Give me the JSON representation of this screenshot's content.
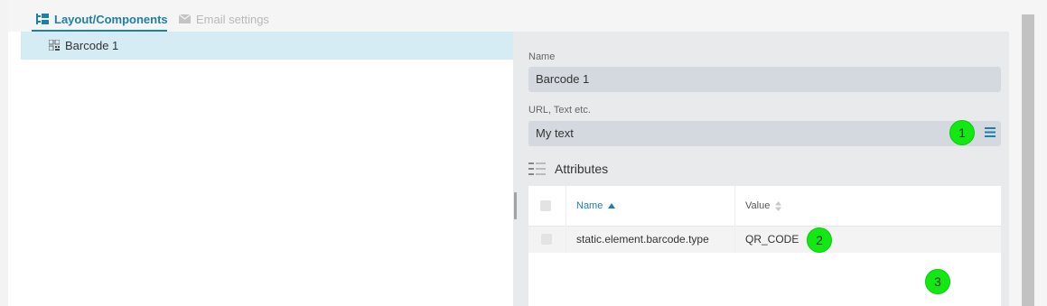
{
  "tabs": [
    {
      "label": "Layout/Components",
      "active": true,
      "icon": "tree-icon"
    },
    {
      "label": "Email settings",
      "active": false,
      "icon": "envelope-icon"
    }
  ],
  "tree": {
    "items": [
      {
        "label": "Barcode 1",
        "icon": "barcode-icon",
        "selected": true
      }
    ]
  },
  "properties": {
    "name_label": "Name",
    "name_value": "Barcode 1",
    "url_label": "URL, Text etc.",
    "url_value": "My text",
    "url_menu_icon": "menu-icon"
  },
  "attributes": {
    "title": "Attributes",
    "icon": "list-icon",
    "columns": [
      {
        "label": "Name",
        "sort": "ascending"
      },
      {
        "label": "Value",
        "sort": "none"
      }
    ],
    "rows": [
      {
        "name": "static.element.barcode.type",
        "value": "QR_CODE"
      }
    ]
  },
  "markers": [
    "1",
    "2",
    "3"
  ],
  "colors": {
    "accent": "#1e7fa8",
    "selected_row": "#d6ecf5",
    "panel_bg": "#e8eaec",
    "input_bg": "#d3d9df",
    "marker": "#12e812"
  }
}
